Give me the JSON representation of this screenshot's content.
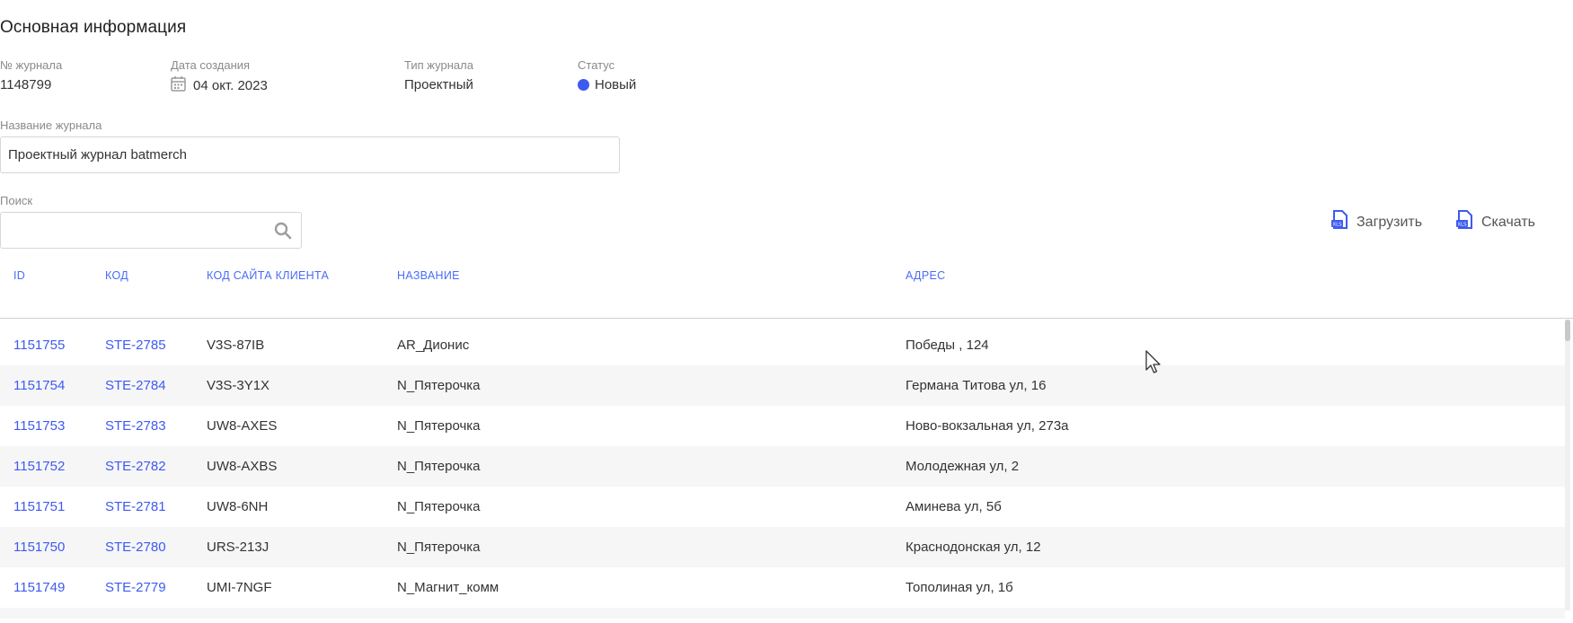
{
  "section_title": "Основная информация",
  "info": {
    "journal_no_label": "№ журнала",
    "journal_no": "1148799",
    "created_label": "Дата создания",
    "created_date": "04 окт. 2023",
    "type_label": "Тип журнала",
    "type_value": "Проектный",
    "status_label": "Статус",
    "status_value": "Новый",
    "status_color": "#3d5af1"
  },
  "name_field": {
    "label": "Название журнала",
    "value": "Проектный журнал batmerch"
  },
  "search": {
    "label": "Поиск",
    "value": ""
  },
  "actions": {
    "upload_label": "Загрузить",
    "download_label": "Скачать"
  },
  "table": {
    "columns": [
      "ID",
      "КОД",
      "КОД САЙТА КЛИЕНТА",
      "НАЗВАНИЕ",
      "АДРЕС"
    ],
    "rows": [
      [
        "1151755",
        "STE-2785",
        "V3S-87IB",
        "AR_Дионис",
        "Победы , 124"
      ],
      [
        "1151754",
        "STE-2784",
        "V3S-3Y1X",
        "N_Пятерочка",
        "Германа Титова ул, 16"
      ],
      [
        "1151753",
        "STE-2783",
        "UW8-AXES",
        "N_Пятерочка",
        "Ново-вокзальная ул, 273а"
      ],
      [
        "1151752",
        "STE-2782",
        "UW8-AXBS",
        "N_Пятерочка",
        "Молодежная ул, 2"
      ],
      [
        "1151751",
        "STE-2781",
        "UW8-6NH",
        "N_Пятерочка",
        "Аминева ул, 5б"
      ],
      [
        "1151750",
        "STE-2780",
        "URS-213J",
        "N_Пятерочка",
        "Краснодонская ул, 12"
      ],
      [
        "1151749",
        "STE-2779",
        "UMI-7NGF",
        "N_Магнит_комм",
        "Тополиная ул, 1б"
      ]
    ]
  },
  "colors": {
    "accent": "#3d5af1",
    "header_text": "#4a6cf7",
    "row_alt": "#f6f6f7"
  }
}
